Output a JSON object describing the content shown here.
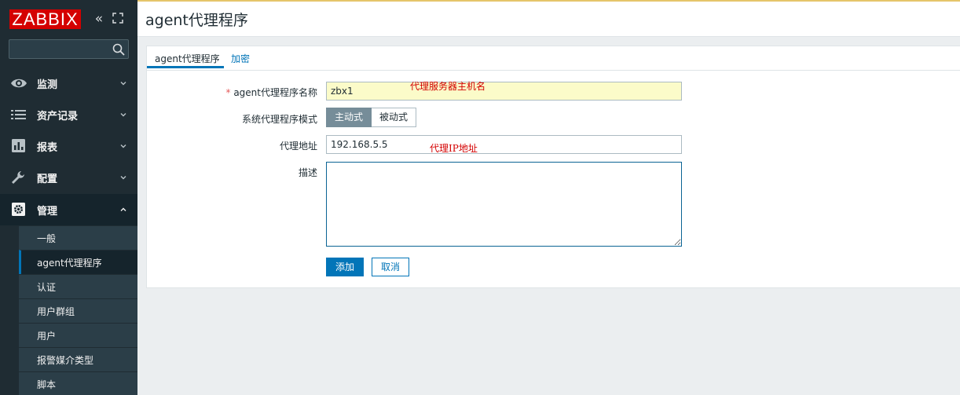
{
  "app": {
    "logo": "ZABBIX",
    "search_placeholder": ""
  },
  "sidebar": {
    "collapse_icon": "«",
    "menu": [
      {
        "label": "监测",
        "icon": "eye-icon"
      },
      {
        "label": "资产记录",
        "icon": "list-icon"
      },
      {
        "label": "报表",
        "icon": "bar-chart-icon"
      },
      {
        "label": "配置",
        "icon": "wrench-icon"
      },
      {
        "label": "管理",
        "icon": "gear-icon"
      }
    ],
    "submenu": [
      "一般",
      "agent代理程序",
      "认证",
      "用户群组",
      "用户",
      "报警媒介类型",
      "脚本"
    ]
  },
  "header": {
    "title": "agent代理程序"
  },
  "tabs": [
    {
      "label": "agent代理程序"
    },
    {
      "label": "加密"
    }
  ],
  "form": {
    "name_label": "agent代理程序名称",
    "name_required_mark": "*",
    "name_value": "zbx1",
    "mode_label": "系统代理程序模式",
    "mode_options": [
      "主动式",
      "被动式"
    ],
    "mode_selected": "主动式",
    "address_label": "代理地址",
    "address_value": "192.168.5.5",
    "description_label": "描述",
    "description_value": ""
  },
  "buttons": {
    "add": "添加",
    "cancel": "取消"
  },
  "annotations": {
    "name_note": "代理服务器主机名",
    "address_note": "代理IP地址"
  },
  "colors": {
    "sidebar": "#1f2c33",
    "accent": "#0275b8",
    "logo": "#d40000",
    "highlight": "#fbfbc9"
  }
}
